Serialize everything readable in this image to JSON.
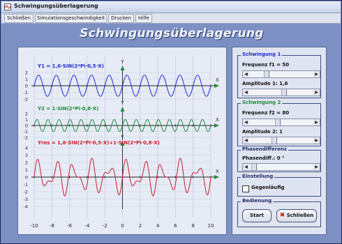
{
  "window": {
    "title": "Schwingungsüberlagerung"
  },
  "menu": [
    {
      "label": "Schließen"
    },
    {
      "label": "Simulationsgeschwindigkeit"
    },
    {
      "label": "Drucken"
    },
    {
      "label": "Hilfe"
    }
  ],
  "app_title": "Schwingungsüberlagerung",
  "chart": {
    "x_ticks": [
      "-10",
      "-8",
      "-6",
      "-4",
      "-2",
      "0",
      "2",
      "4",
      "6",
      "8",
      "10"
    ],
    "axis_label_x": "X",
    "axis_label_y": "Y",
    "panels": [
      {
        "formula": "Y1 = 1,6·SIN(2*Pi·0,5·X)",
        "color": "#1e2bd0",
        "y_ticks": [
          "2",
          "1",
          "0",
          "-1",
          "-2"
        ]
      },
      {
        "formula": "Y2 = 1·SIN(2*Pi·0,8·X)",
        "color": "#1f8a3a",
        "y_ticks": [
          "2",
          "1",
          "0",
          "-1",
          "-2"
        ]
      },
      {
        "formula": "Yres = 1,6·SIN(2*Pi·0,5·X)+1·SIN(2*Pi·0,8·X)",
        "color": "#c81e2a",
        "y_ticks": [
          "4",
          "3",
          "2",
          "1",
          "0",
          "-1",
          "-2",
          "-3",
          "-4"
        ]
      }
    ]
  },
  "chart_data": {
    "type": "line",
    "x_range": [
      -10,
      10
    ],
    "series": [
      {
        "name": "Y1",
        "amplitude": 1.6,
        "frequency": 0.5,
        "values_formula": "1,6·SIN(2*Pi·0,5·X)"
      },
      {
        "name": "Y2",
        "amplitude": 1,
        "frequency": 0.8,
        "values_formula": "1·SIN(2*Pi·0,8·X)"
      },
      {
        "name": "Yres",
        "values_formula": "1,6·SIN(2*Pi·0,5·X)+1·SIN(2*Pi·0,8·X)"
      }
    ],
    "ylim_panels": [
      [
        -2,
        2
      ],
      [
        -2,
        2
      ],
      [
        -4,
        4
      ]
    ]
  },
  "controls": {
    "group1": {
      "legend": "Schwingung 1",
      "freq_label": "Frequenz f1 = 50",
      "amp_label": "Amplitude 1:  1,6",
      "freq_value": 0.25,
      "amp_value": 0.55
    },
    "group2": {
      "legend": "Schwingung 2",
      "freq_label": "Frequenz f2 = 80",
      "amp_label": "Amplitude 2:  1",
      "freq_value": 0.44,
      "amp_value": 0.38
    },
    "phase": {
      "legend": "Phasendifferenz",
      "label": "Phasendiff.:   0 °",
      "value": 0.02
    },
    "setting": {
      "legend": "Einstellung",
      "checkbox_label": "Gegenläufig",
      "checked": false
    },
    "operation": {
      "legend": "Bedienung",
      "start_label": "Start",
      "close_label": "Schließen"
    }
  }
}
